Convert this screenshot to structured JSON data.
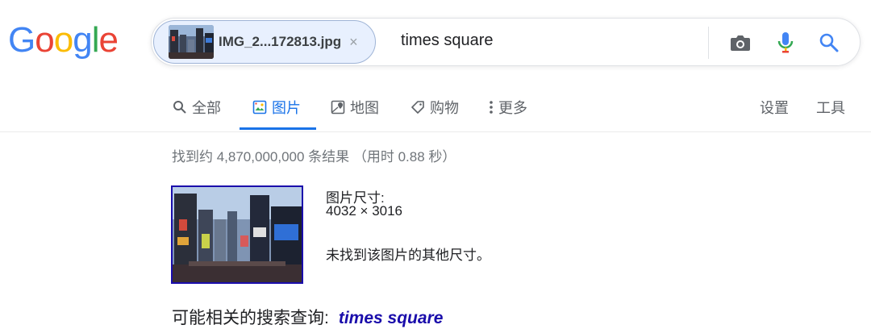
{
  "logo": {
    "text": "Google",
    "letters": [
      {
        "ch": "G",
        "color": "#4285f4"
      },
      {
        "ch": "o",
        "color": "#ea4335"
      },
      {
        "ch": "o",
        "color": "#fbbc05"
      },
      {
        "ch": "g",
        "color": "#4285f4"
      },
      {
        "ch": "l",
        "color": "#34a853"
      },
      {
        "ch": "e",
        "color": "#ea4335"
      }
    ]
  },
  "search": {
    "chip_filename": "IMG_2...172813.jpg",
    "chip_close": "×",
    "query": "times square",
    "icons": [
      "camera-icon",
      "microphone-icon",
      "search-icon"
    ]
  },
  "tabs": [
    {
      "label": "全部",
      "icon": "search-icon",
      "active": false
    },
    {
      "label": "图片",
      "icon": "image-icon",
      "active": true
    },
    {
      "label": "地图",
      "icon": "map-icon",
      "active": false
    },
    {
      "label": "购物",
      "icon": "tag-icon",
      "active": false
    },
    {
      "label": "更多",
      "icon": "more-vertical-icon",
      "active": false
    }
  ],
  "tools": {
    "settings": "设置",
    "tools": "工具"
  },
  "results": {
    "stats": "找到约 4,870,000,000 条结果 （用时 0.88 秒）",
    "size_label": "图片尺寸:",
    "size_value": "4032 × 3016",
    "no_other_sizes": "未找到该图片的其他尺寸。"
  },
  "related": {
    "label": "可能相关的搜索查询:",
    "link": "times square"
  },
  "colors": {
    "accent": "#1a73e8",
    "link": "#1a0dab",
    "muted": "#70757a"
  }
}
